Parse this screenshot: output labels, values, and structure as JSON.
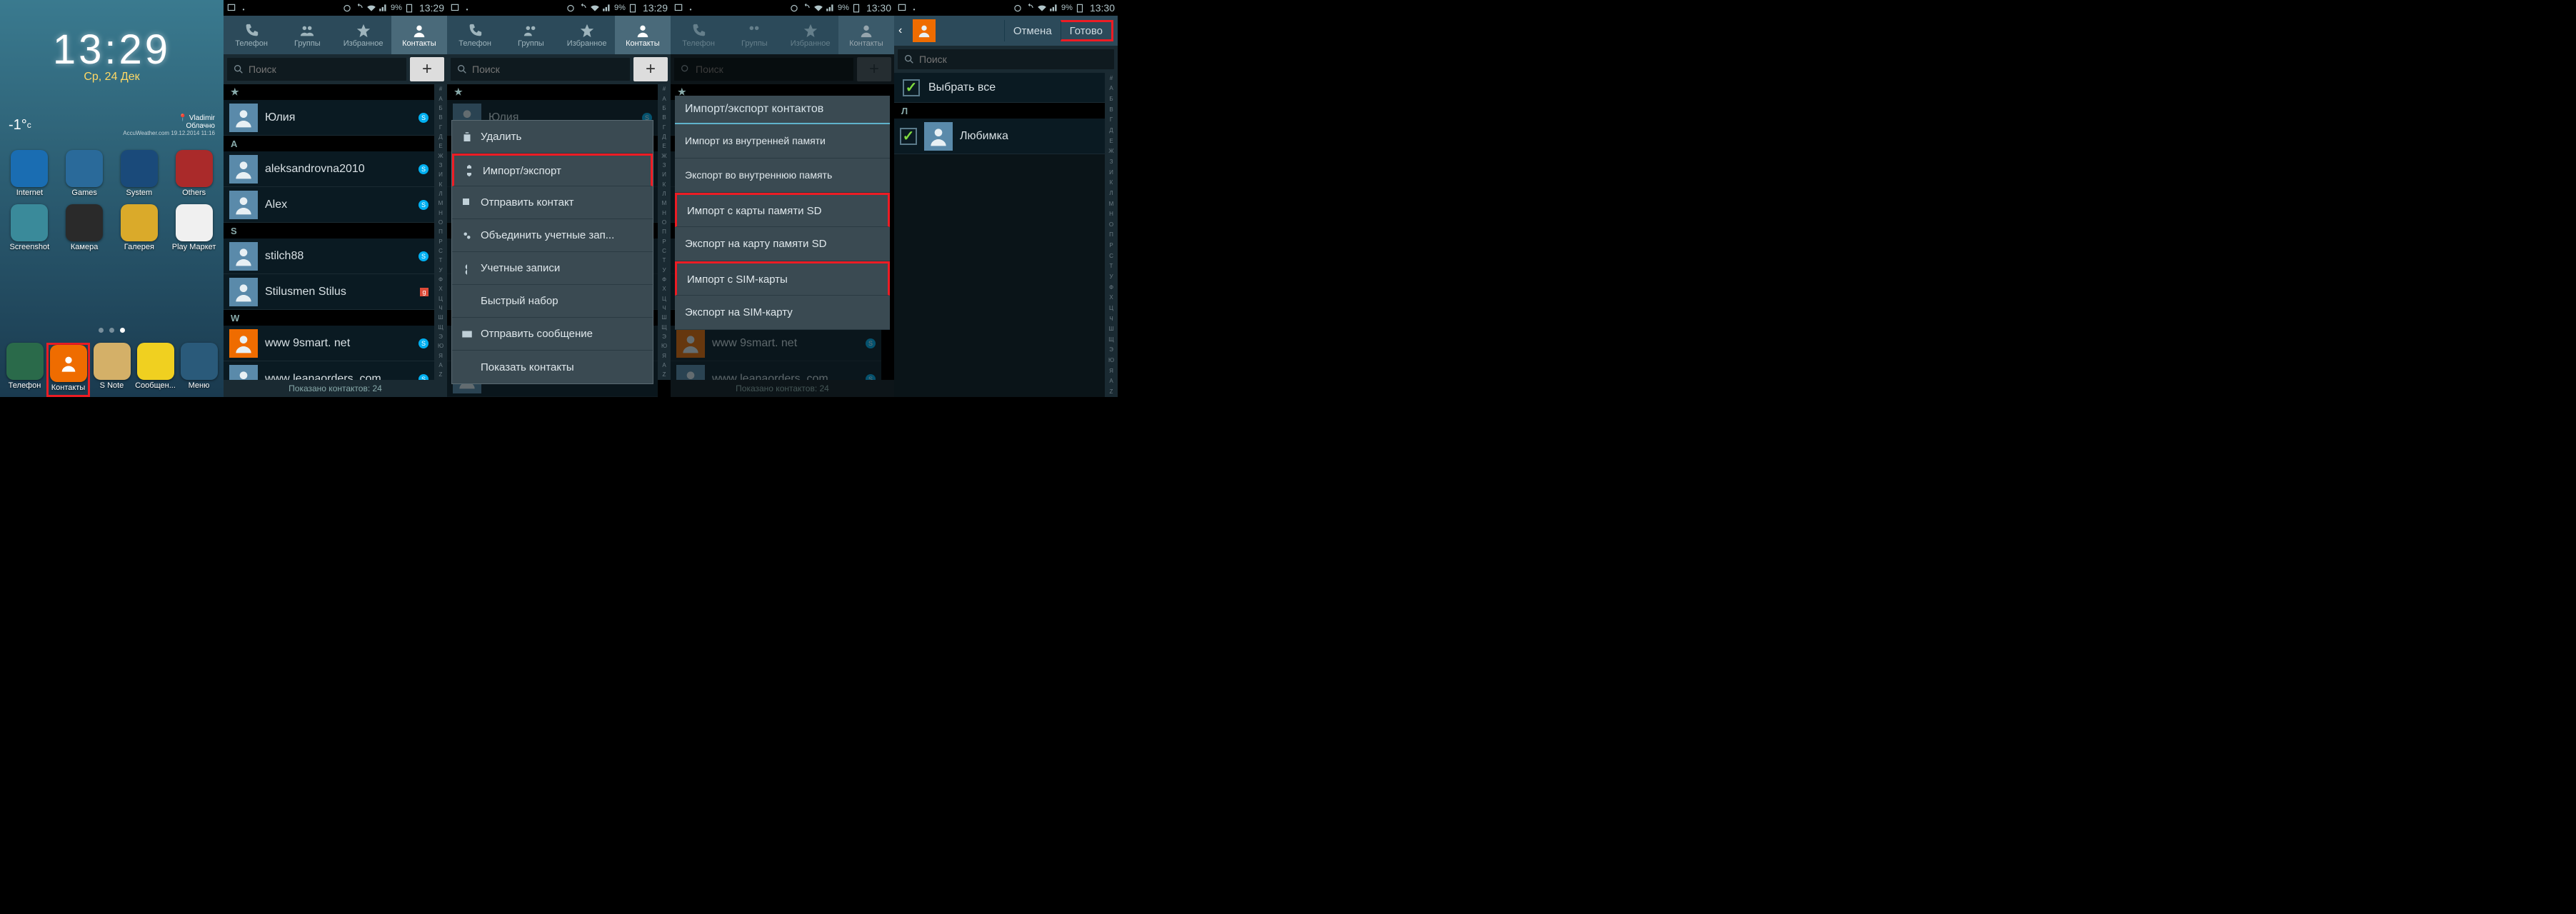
{
  "status": {
    "battery": "9%",
    "times": [
      "13:29",
      "13:29",
      "13:29",
      "13:30",
      "13:30"
    ]
  },
  "home": {
    "time": "13:29",
    "date": "Ср, 24 Дек",
    "temp": "-1°",
    "temp_unit": "c",
    "city": "Vladimir",
    "condition": "Облачно",
    "weather_src": "AccuWeather.com",
    "weather_ts": "19.12.2014 11:16",
    "apps": [
      {
        "label": "Internet",
        "color": "#1a6db2"
      },
      {
        "label": "Games",
        "color": "#2a6a9a"
      },
      {
        "label": "System",
        "color": "#1a4a7a"
      },
      {
        "label": "Others",
        "color": "#aa2a2a"
      },
      {
        "label": "Screenshot",
        "color": "#3a8a9a"
      },
      {
        "label": "Камера",
        "color": "#2a2a2a"
      },
      {
        "label": "Галерея",
        "color": "#daaa2a"
      },
      {
        "label": "Play Маркет",
        "color": "#f0f0f0"
      }
    ],
    "dock": [
      {
        "label": "Телефон",
        "color": "#2a6a4a"
      },
      {
        "label": "Контакты",
        "color": "#ef6c00"
      },
      {
        "label": "S Note",
        "color": "#d4b068"
      },
      {
        "label": "Сообщен...",
        "color": "#f0d020"
      },
      {
        "label": "Меню",
        "color": "#2a5a7a"
      }
    ]
  },
  "tabs": {
    "phone": "Телефон",
    "groups": "Группы",
    "favorites": "Избранное",
    "contacts": "Контакты"
  },
  "search": {
    "placeholder": "Поиск"
  },
  "contacts": {
    "star": {
      "name": "Юлия",
      "skype": true
    },
    "sectionA": "A",
    "a": [
      {
        "name": "aleksandrovna2010",
        "skype": true
      },
      {
        "name": "Alex",
        "skype": true
      }
    ],
    "sectionS": "S",
    "s": [
      {
        "name": "stilch88",
        "skype": true
      },
      {
        "name": "Stilusmen Stilus",
        "gplus": true
      }
    ],
    "sectionW": "W",
    "w": [
      {
        "name": "www 9smart. net",
        "skype": true,
        "orange": true
      },
      {
        "name": "www leanaorders. com",
        "skype": true
      }
    ],
    "footer": "Показано контактов: 24"
  },
  "menu": {
    "items": [
      "Удалить",
      "Импорт/экспорт",
      "Отправить контакт",
      "Объединить учетные зап...",
      "Учетные записи",
      "Быстрый набор",
      "Отправить сообщение",
      "Показать контакты"
    ]
  },
  "dialog": {
    "title": "Импорт/экспорт контактов",
    "options": [
      "Импорт из внутренней памяти",
      "Экспорт во внутреннюю память",
      "Импорт с карты памяти SD",
      "Экспорт на карту памяти SD",
      "Импорт с SIM-карты",
      "Экспорт на SIM-карту"
    ]
  },
  "select": {
    "cancel": "Отмена",
    "done": "Готово",
    "select_all": "Выбрать все",
    "sectionL": "Л",
    "contact": "Любимка"
  },
  "index_letters": [
    "#",
    "А",
    "Б",
    "В",
    "Г",
    "Д",
    "Е",
    "Ж",
    "З",
    "И",
    "К",
    "Л",
    "М",
    "Н",
    "О",
    "П",
    "Р",
    "С",
    "Т",
    "У",
    "Ф",
    "Х",
    "Ц",
    "Ч",
    "Ш",
    "Щ",
    "Э",
    "Ю",
    "Я",
    "A",
    "Z"
  ]
}
